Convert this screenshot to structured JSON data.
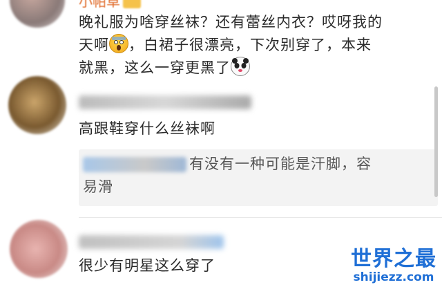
{
  "comments": [
    {
      "username": "小帕草",
      "lines": [
        "晚礼服为啥穿丝袜？还有蕾丝内衣？哎呀我的",
        "天啊",
        "，白裙子很漂亮，下次别穿了，本来",
        "就黑，这么一穿更黑了"
      ],
      "emojis": [
        "scream-emoji",
        "panda-emoji"
      ]
    },
    {
      "text": "高跟鞋穿什么丝袜啊",
      "reply": {
        "line1": "有没有一种可能是汗脚，容",
        "line2": "易滑"
      }
    },
    {
      "text": "很少有明星这么穿了"
    }
  ],
  "watermark": {
    "title": "世界之最",
    "url": "shijiezz.com"
  },
  "colors": {
    "accent": "#1f6fd6",
    "username": "#e06b2a",
    "reply_bg": "#f3f3f3"
  }
}
